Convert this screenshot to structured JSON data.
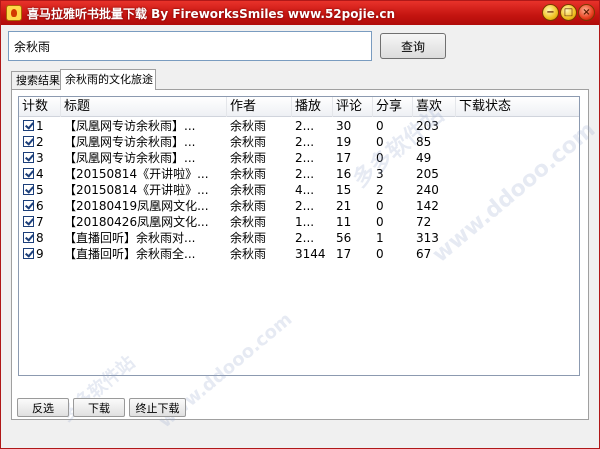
{
  "window": {
    "title": "喜马拉雅听书批量下载 By FireworksSmiles www.52pojie.cn",
    "controls": {
      "minimize": "−",
      "maximize": "□",
      "close": "×"
    }
  },
  "search": {
    "value": "余秋雨",
    "button_label": "查询"
  },
  "tabs": [
    {
      "label": "搜索结果"
    },
    {
      "label": "余秋雨的文化旅途"
    }
  ],
  "table": {
    "columns": [
      "计数",
      "标题",
      "作者",
      "播放",
      "评论",
      "分享",
      "喜欢",
      "下载状态"
    ],
    "rows": [
      {
        "num": "1",
        "title": "【凤凰网专访余秋雨】...",
        "author": "余秋雨",
        "plays": "2...",
        "comments": "30",
        "shares": "0",
        "likes": "203",
        "status": ""
      },
      {
        "num": "2",
        "title": "【凤凰网专访余秋雨】...",
        "author": "余秋雨",
        "plays": "2...",
        "comments": "19",
        "shares": "0",
        "likes": "85",
        "status": ""
      },
      {
        "num": "3",
        "title": "【凤凰网专访余秋雨】...",
        "author": "余秋雨",
        "plays": "2...",
        "comments": "17",
        "shares": "0",
        "likes": "49",
        "status": ""
      },
      {
        "num": "4",
        "title": "【20150814《开讲啦》...",
        "author": "余秋雨",
        "plays": "2...",
        "comments": "16",
        "shares": "3",
        "likes": "205",
        "status": ""
      },
      {
        "num": "5",
        "title": "【20150814《开讲啦》...",
        "author": "余秋雨",
        "plays": "4...",
        "comments": "15",
        "shares": "2",
        "likes": "240",
        "status": ""
      },
      {
        "num": "6",
        "title": "【20180419凤凰网文化...",
        "author": "余秋雨",
        "plays": "2...",
        "comments": "21",
        "shares": "0",
        "likes": "142",
        "status": ""
      },
      {
        "num": "7",
        "title": "【20180426凤凰网文化...",
        "author": "余秋雨",
        "plays": "1...",
        "comments": "11",
        "shares": "0",
        "likes": "72",
        "status": ""
      },
      {
        "num": "8",
        "title": "【直播回听】余秋雨对...",
        "author": "余秋雨",
        "plays": "2...",
        "comments": "56",
        "shares": "1",
        "likes": "313",
        "status": ""
      },
      {
        "num": "9",
        "title": "【直播回听】余秋雨全...",
        "author": "余秋雨",
        "plays": "3144",
        "comments": "17",
        "shares": "0",
        "likes": "67",
        "status": ""
      }
    ]
  },
  "buttons": {
    "invert": "反选",
    "download": "下载",
    "stop": "终止下载"
  },
  "watermarks": [
    "多多软件站",
    "www.ddooo.com",
    "多多软件站",
    "www.ddooo.com"
  ]
}
